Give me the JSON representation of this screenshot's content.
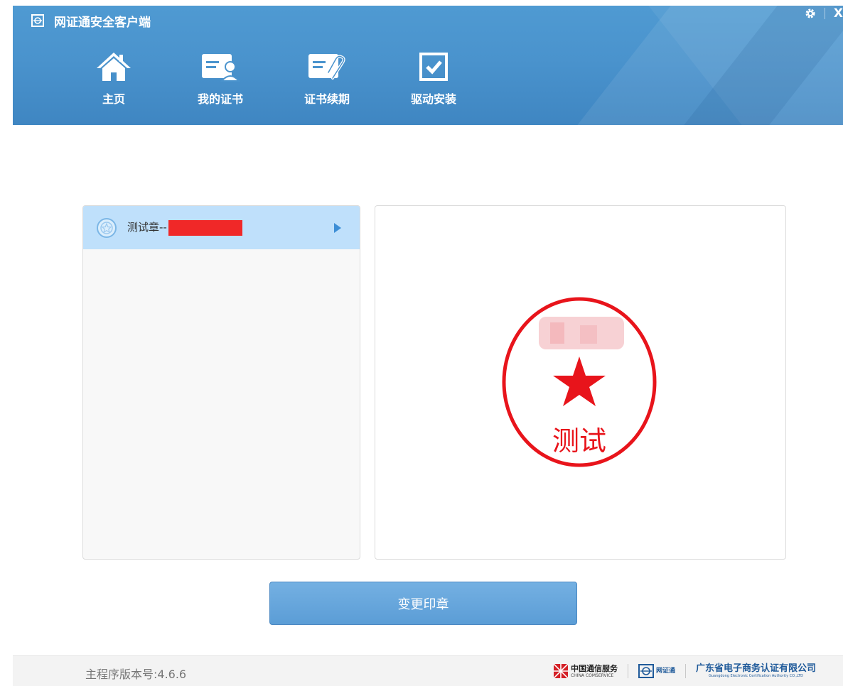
{
  "app": {
    "title": "网证通安全客户端"
  },
  "window_controls": {
    "settings_icon": "gear-icon",
    "close_label": "X"
  },
  "nav": [
    {
      "label": "主页",
      "icon": "home-icon"
    },
    {
      "label": "我的证书",
      "icon": "certificate-user-icon"
    },
    {
      "label": "证书续期",
      "icon": "certificate-renew-icon"
    },
    {
      "label": "驱动安装",
      "icon": "checkbox-icon"
    }
  ],
  "seal_list": {
    "items": [
      {
        "label": "测试章--",
        "icon": "seal-icon",
        "selected": true
      }
    ]
  },
  "preview": {
    "stamp_text": "测试",
    "stamp_color": "#e8141b"
  },
  "actions": {
    "change_seal_label": "变更印章"
  },
  "footer": {
    "version_label": "主程序版本号:4.6.6",
    "logo_china_comservice_cn": "中国通信服务",
    "logo_china_comservice_en": "CHINA COMSERVICE",
    "logo_netca": "网证通",
    "logo_gdca_cn": "广东省电子商务认证有限公司",
    "logo_gdca_en": "Guangdong Electronic Certification Authority CO.,LTD"
  },
  "colors": {
    "header_blue": "#4a93cd",
    "selected_row": "#bfe0fb",
    "button_blue": "#5b9dd6",
    "accent_arrow": "#3c8ed6"
  }
}
